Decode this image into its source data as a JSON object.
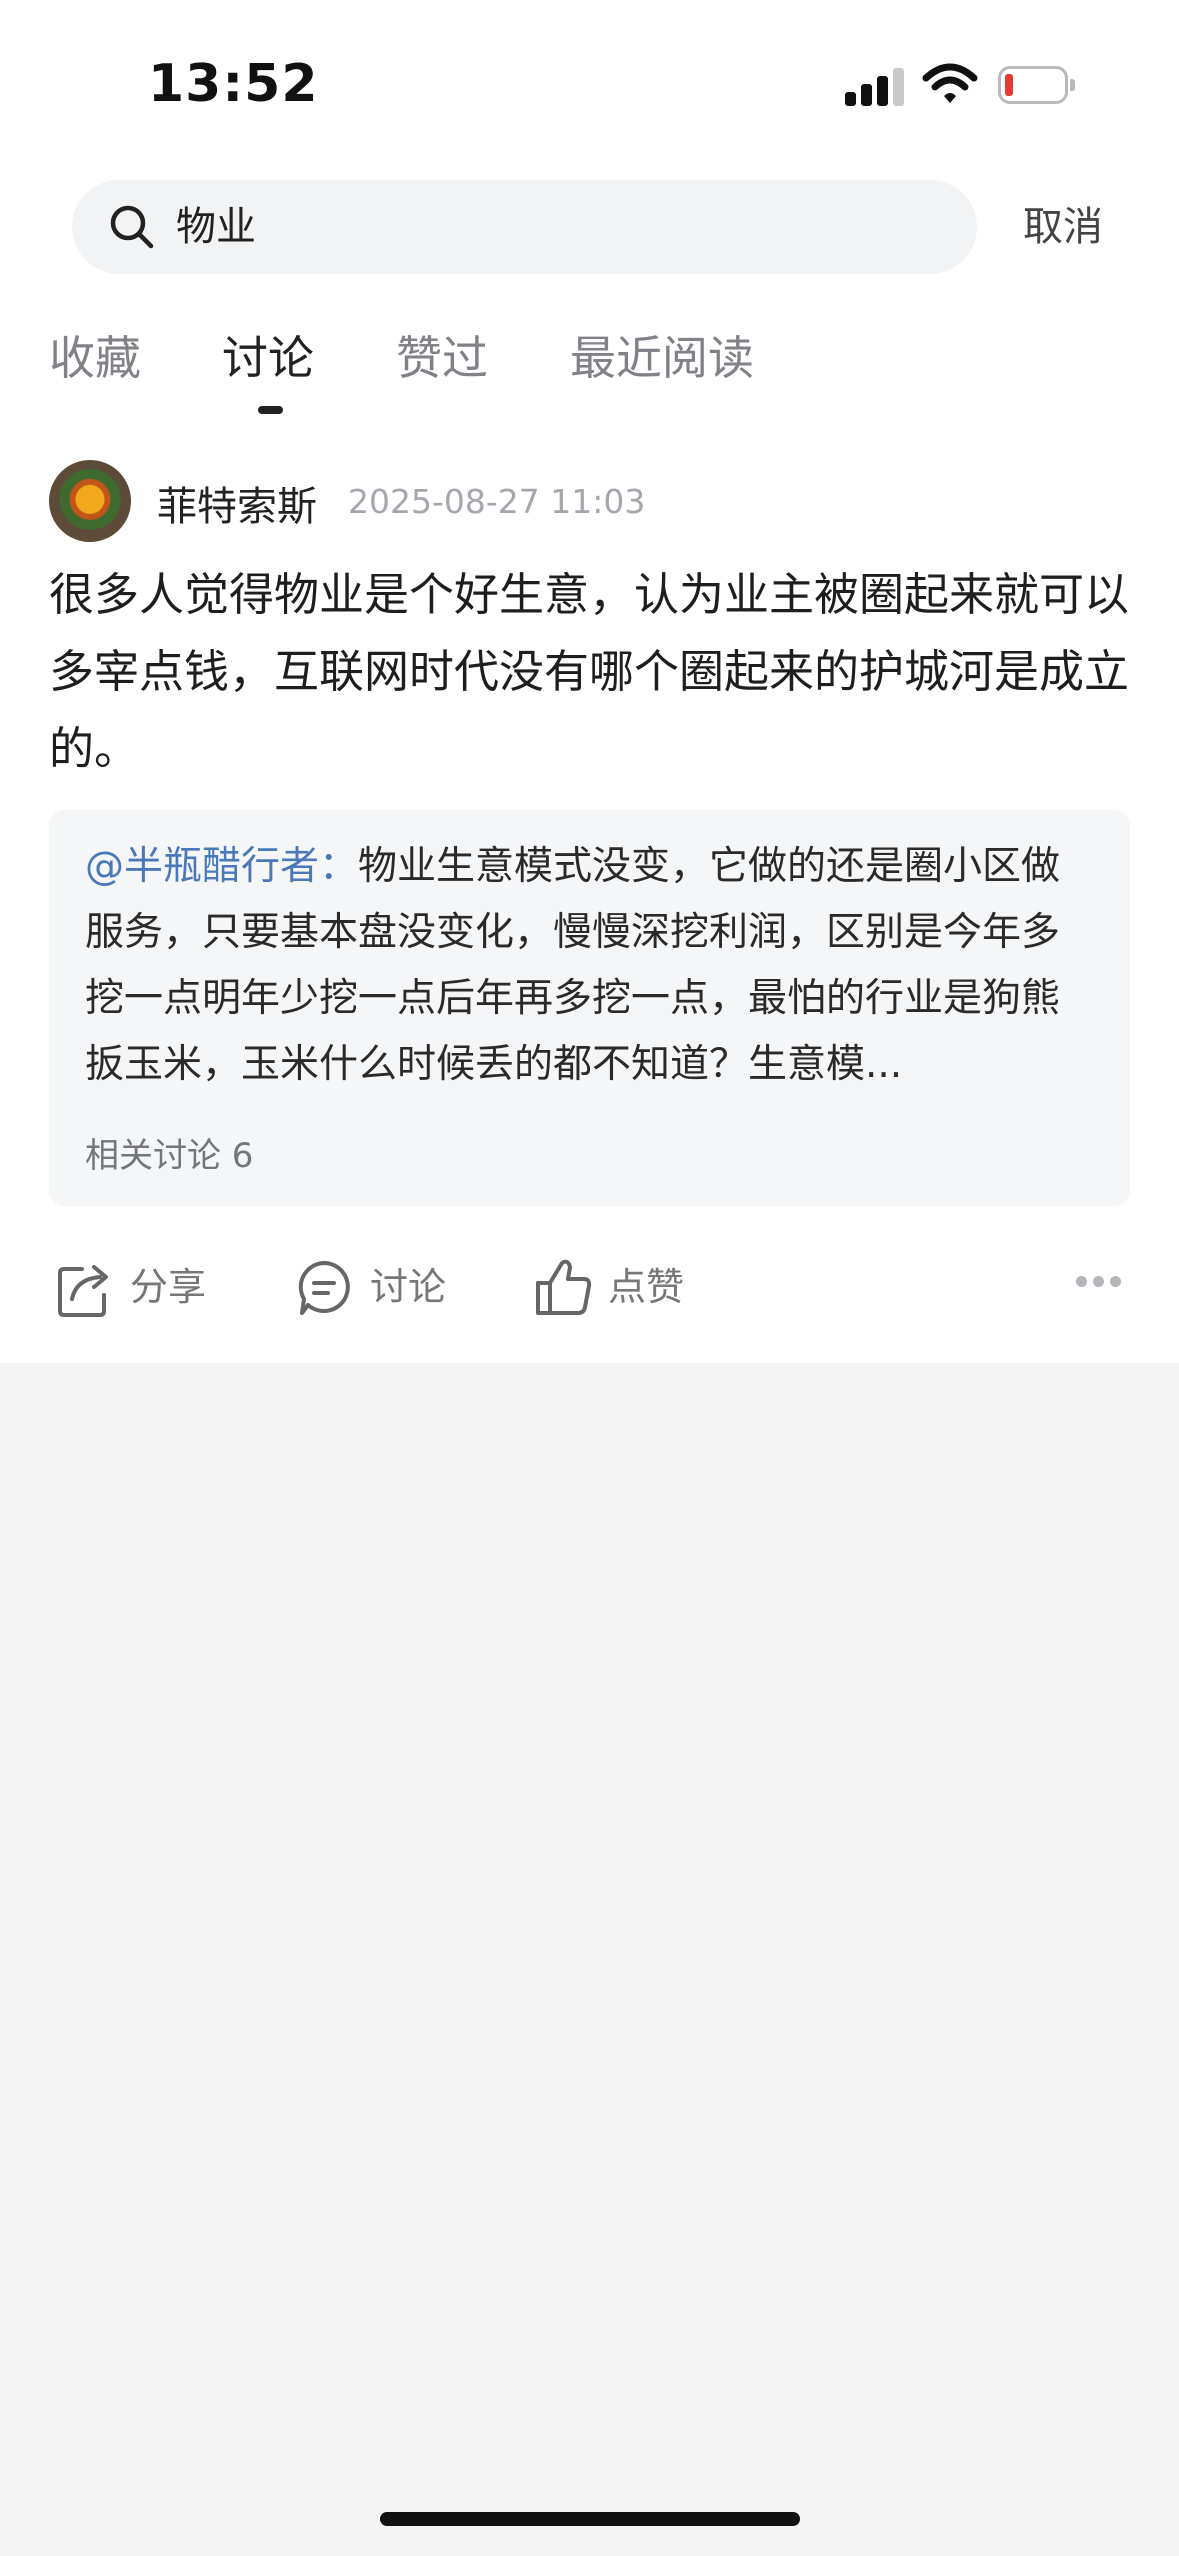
{
  "status_bar": {
    "time": "13:52"
  },
  "search": {
    "query": "物业",
    "cancel_label": "取消"
  },
  "tabs": [
    {
      "label": "收藏"
    },
    {
      "label": "讨论"
    },
    {
      "label": "赞过"
    },
    {
      "label": "最近阅读"
    }
  ],
  "active_tab": "讨论",
  "post": {
    "author": "菲特索斯",
    "timestamp": "2025-08-27 11:03",
    "text": "很多人觉得物业是个好生意，认为业主被圈起来就可以多宰点钱，互联网时代没有哪个圈起来的护城河是成立的。",
    "quote": {
      "mention": "@半瓶醋行者：",
      "text": "物业生意模式没变，它做的还是圈小区做服务，只要基本盘没变化，慢慢深挖利润，区别是今年多挖一点明年少挖一点后年再多挖一点，最怕的行业是狗熊扳玉米，玉米什么时候丢的都不知道？生意模...",
      "related": "相关讨论 6"
    }
  },
  "actions": {
    "share": "分享",
    "discuss": "讨论",
    "like": "点赞"
  },
  "colors": {
    "mention": "#4a78b8",
    "battery_low": "#e53935",
    "page_bg": "#f4f4f5"
  }
}
